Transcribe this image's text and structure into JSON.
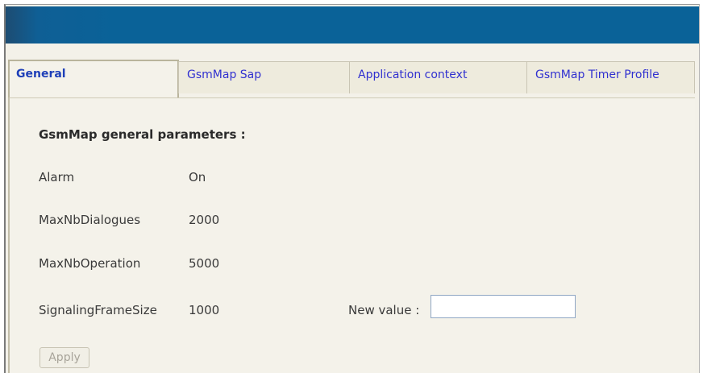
{
  "tabs": {
    "general": "General",
    "gsmmap_sap": "GsmMap Sap",
    "application_context": "Application context",
    "timer_profile": "GsmMap Timer Profile"
  },
  "section": {
    "title": "GsmMap general parameters :"
  },
  "params": {
    "alarm": {
      "label": "Alarm",
      "value": "On"
    },
    "max_dialogues": {
      "label": "MaxNbDialogues",
      "value": "2000"
    },
    "max_operation": {
      "label": "MaxNbOperation",
      "value": "5000"
    },
    "signaling_frame_size": {
      "label": "SignalingFrameSize",
      "value": "1000"
    }
  },
  "new_value": {
    "label": "New value :",
    "value": ""
  },
  "buttons": {
    "apply": "Apply"
  },
  "colors": {
    "titlebar": "#0a6298",
    "tab_text": "#3030d0",
    "panel_bg": "#f4f2ea"
  }
}
